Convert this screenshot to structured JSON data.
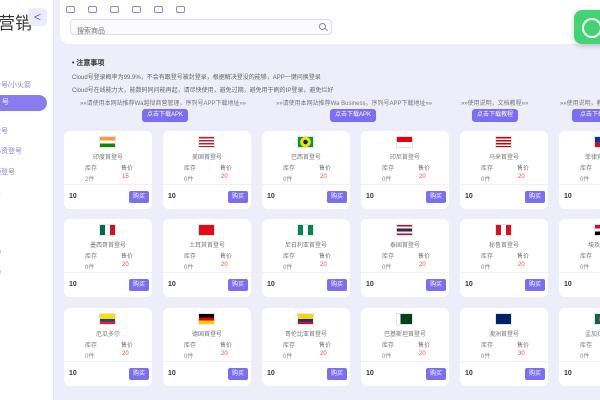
{
  "sidebar": {
    "brand": "营销",
    "collapse_glyph": "<",
    "items": [
      {
        "label": "台号/小火箭"
      },
      {
        "label": "号",
        "active": true
      },
      {
        "label": "登号"
      },
      {
        "label": "码资登号"
      },
      {
        "label": "频登号"
      },
      {
        "label": "号"
      },
      {
        "label": "码"
      },
      {
        "label": "码"
      }
    ]
  },
  "header": {
    "search_placeholder": "搜索商品"
  },
  "notice": {
    "title": "• 注意事项",
    "lines": [
      "Cloud号登录概率为99.9%，不会有跟登号被封登录，根据解决登没的能够，APP一键问换登录",
      "Cloud号在线能力大，能数码同问能再起，请尽快使用，避免过期，避免用于刷的IP登录，避免烂好"
    ],
    "promos": [
      {
        "text": "»»请使用本网站推荐Wa越狱商营管理，序列号APP下载地址»»",
        "button": "点击下载APK"
      },
      {
        "text": "»»请使用本网站推荐Wa Business，序列号APP下载地址»»",
        "button": "点击下载APK"
      },
      {
        "text": "»»使用说明，文档教程»»",
        "button": "点击下载教程"
      },
      {
        "text": "»»使用说明，教",
        "button": "点击下载"
      }
    ]
  },
  "product_labels": {
    "stock": "库存",
    "price": "售价",
    "buy": "购买"
  },
  "products": [
    {
      "name": "印度首登号",
      "stock": "2件",
      "price": "15",
      "qty": "10",
      "flag": "india"
    },
    {
      "name": "美国首登号",
      "stock": "0件",
      "price": "20",
      "qty": "10",
      "flag": "usa"
    },
    {
      "name": "巴西首登号",
      "stock": "0件",
      "price": "20",
      "qty": "10",
      "flag": "brazil"
    },
    {
      "name": "印尼首登号",
      "stock": "0件",
      "price": "20",
      "qty": "10",
      "flag": "indonesia"
    },
    {
      "name": "马来首登号",
      "stock": "0件",
      "price": "20",
      "qty": "10",
      "flag": "malaysia"
    },
    {
      "name": "菲律宾首登号",
      "stock": "0件",
      "price": "20",
      "qty": "10",
      "flag": "philippines"
    },
    {
      "name": "墨西哥首登号",
      "stock": "0件",
      "price": "20",
      "qty": "10",
      "flag": "mexico"
    },
    {
      "name": "土耳其首登号",
      "stock": "0件",
      "price": "20",
      "qty": "10",
      "flag": "turkey"
    },
    {
      "name": "尼日利亚首登号",
      "stock": "0件",
      "price": "20",
      "qty": "10",
      "flag": "nigeria"
    },
    {
      "name": "泰国首登号",
      "stock": "0件",
      "price": "20",
      "qty": "10",
      "flag": "thailand"
    },
    {
      "name": "秘鲁首登号",
      "stock": "0件",
      "price": "20",
      "qty": "10",
      "flag": "peru"
    },
    {
      "name": "埃及首登号",
      "stock": "0件",
      "price": "20",
      "qty": "10",
      "flag": "egypt"
    },
    {
      "name": "厄瓜多尔",
      "stock": "0件",
      "price": "20",
      "qty": "10",
      "flag": "ecuador"
    },
    {
      "name": "德国首登号",
      "stock": "0件",
      "price": "20",
      "qty": "10",
      "flag": "germany"
    },
    {
      "name": "哥伦比亚首登号",
      "stock": "0件",
      "price": "20",
      "qty": "10",
      "flag": "colombia"
    },
    {
      "name": "巴基斯坦首登号",
      "stock": "0件",
      "price": "20",
      "qty": "10",
      "flag": "pakistan"
    },
    {
      "name": "澳洲首登号",
      "stock": "0件",
      "price": "30",
      "qty": "10",
      "flag": "australia"
    },
    {
      "name": "孟加拉首登号",
      "stock": "0件",
      "price": "20",
      "qty": "10",
      "flag": "bangladesh"
    }
  ],
  "colors": {
    "accent": "#7c6ef0",
    "price": "#e0533c",
    "background": "#eeeefb"
  }
}
